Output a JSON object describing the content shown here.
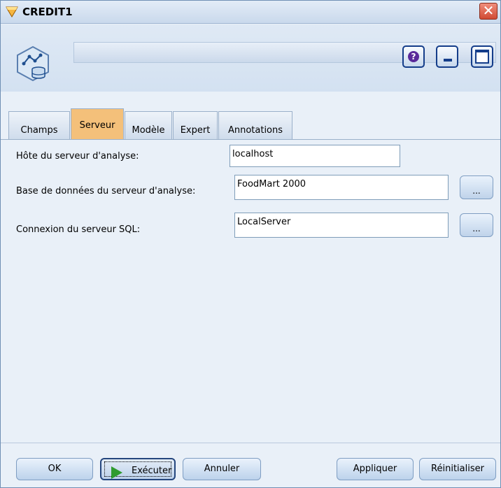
{
  "window": {
    "title": "CREDIT1",
    "close_glyph": "✕",
    "name_value": ""
  },
  "header": {
    "help_glyph": "?"
  },
  "tabs": [
    {
      "label": "Champs"
    },
    {
      "label": "Serveur"
    },
    {
      "label": "Modèle"
    },
    {
      "label": "Expert"
    },
    {
      "label": "Annotations"
    }
  ],
  "active_tab": "Serveur",
  "form": {
    "host_label": "Hôte du serveur d'analyse:",
    "host_value": "localhost",
    "db_label": "Base de données du serveur d'analyse:",
    "db_value": "FoodMart 2000",
    "db_browse": "...",
    "sql_label": "Connexion du serveur SQL:",
    "sql_value": "LocalServer",
    "sql_browse": "..."
  },
  "footer": {
    "ok": "OK",
    "run": "Exécuter",
    "cancel": "Annuler",
    "apply": "Appliquer",
    "reset": "Réinitialiser"
  },
  "colors": {
    "active_tab": "#f4c07a",
    "accent": "#143d8a",
    "run_icon": "#2f9b2f"
  },
  "icons": [
    "diamond-app-icon",
    "model-node-icon",
    "help-icon",
    "minimize-icon",
    "maximize-icon",
    "close-icon",
    "play-icon"
  ]
}
